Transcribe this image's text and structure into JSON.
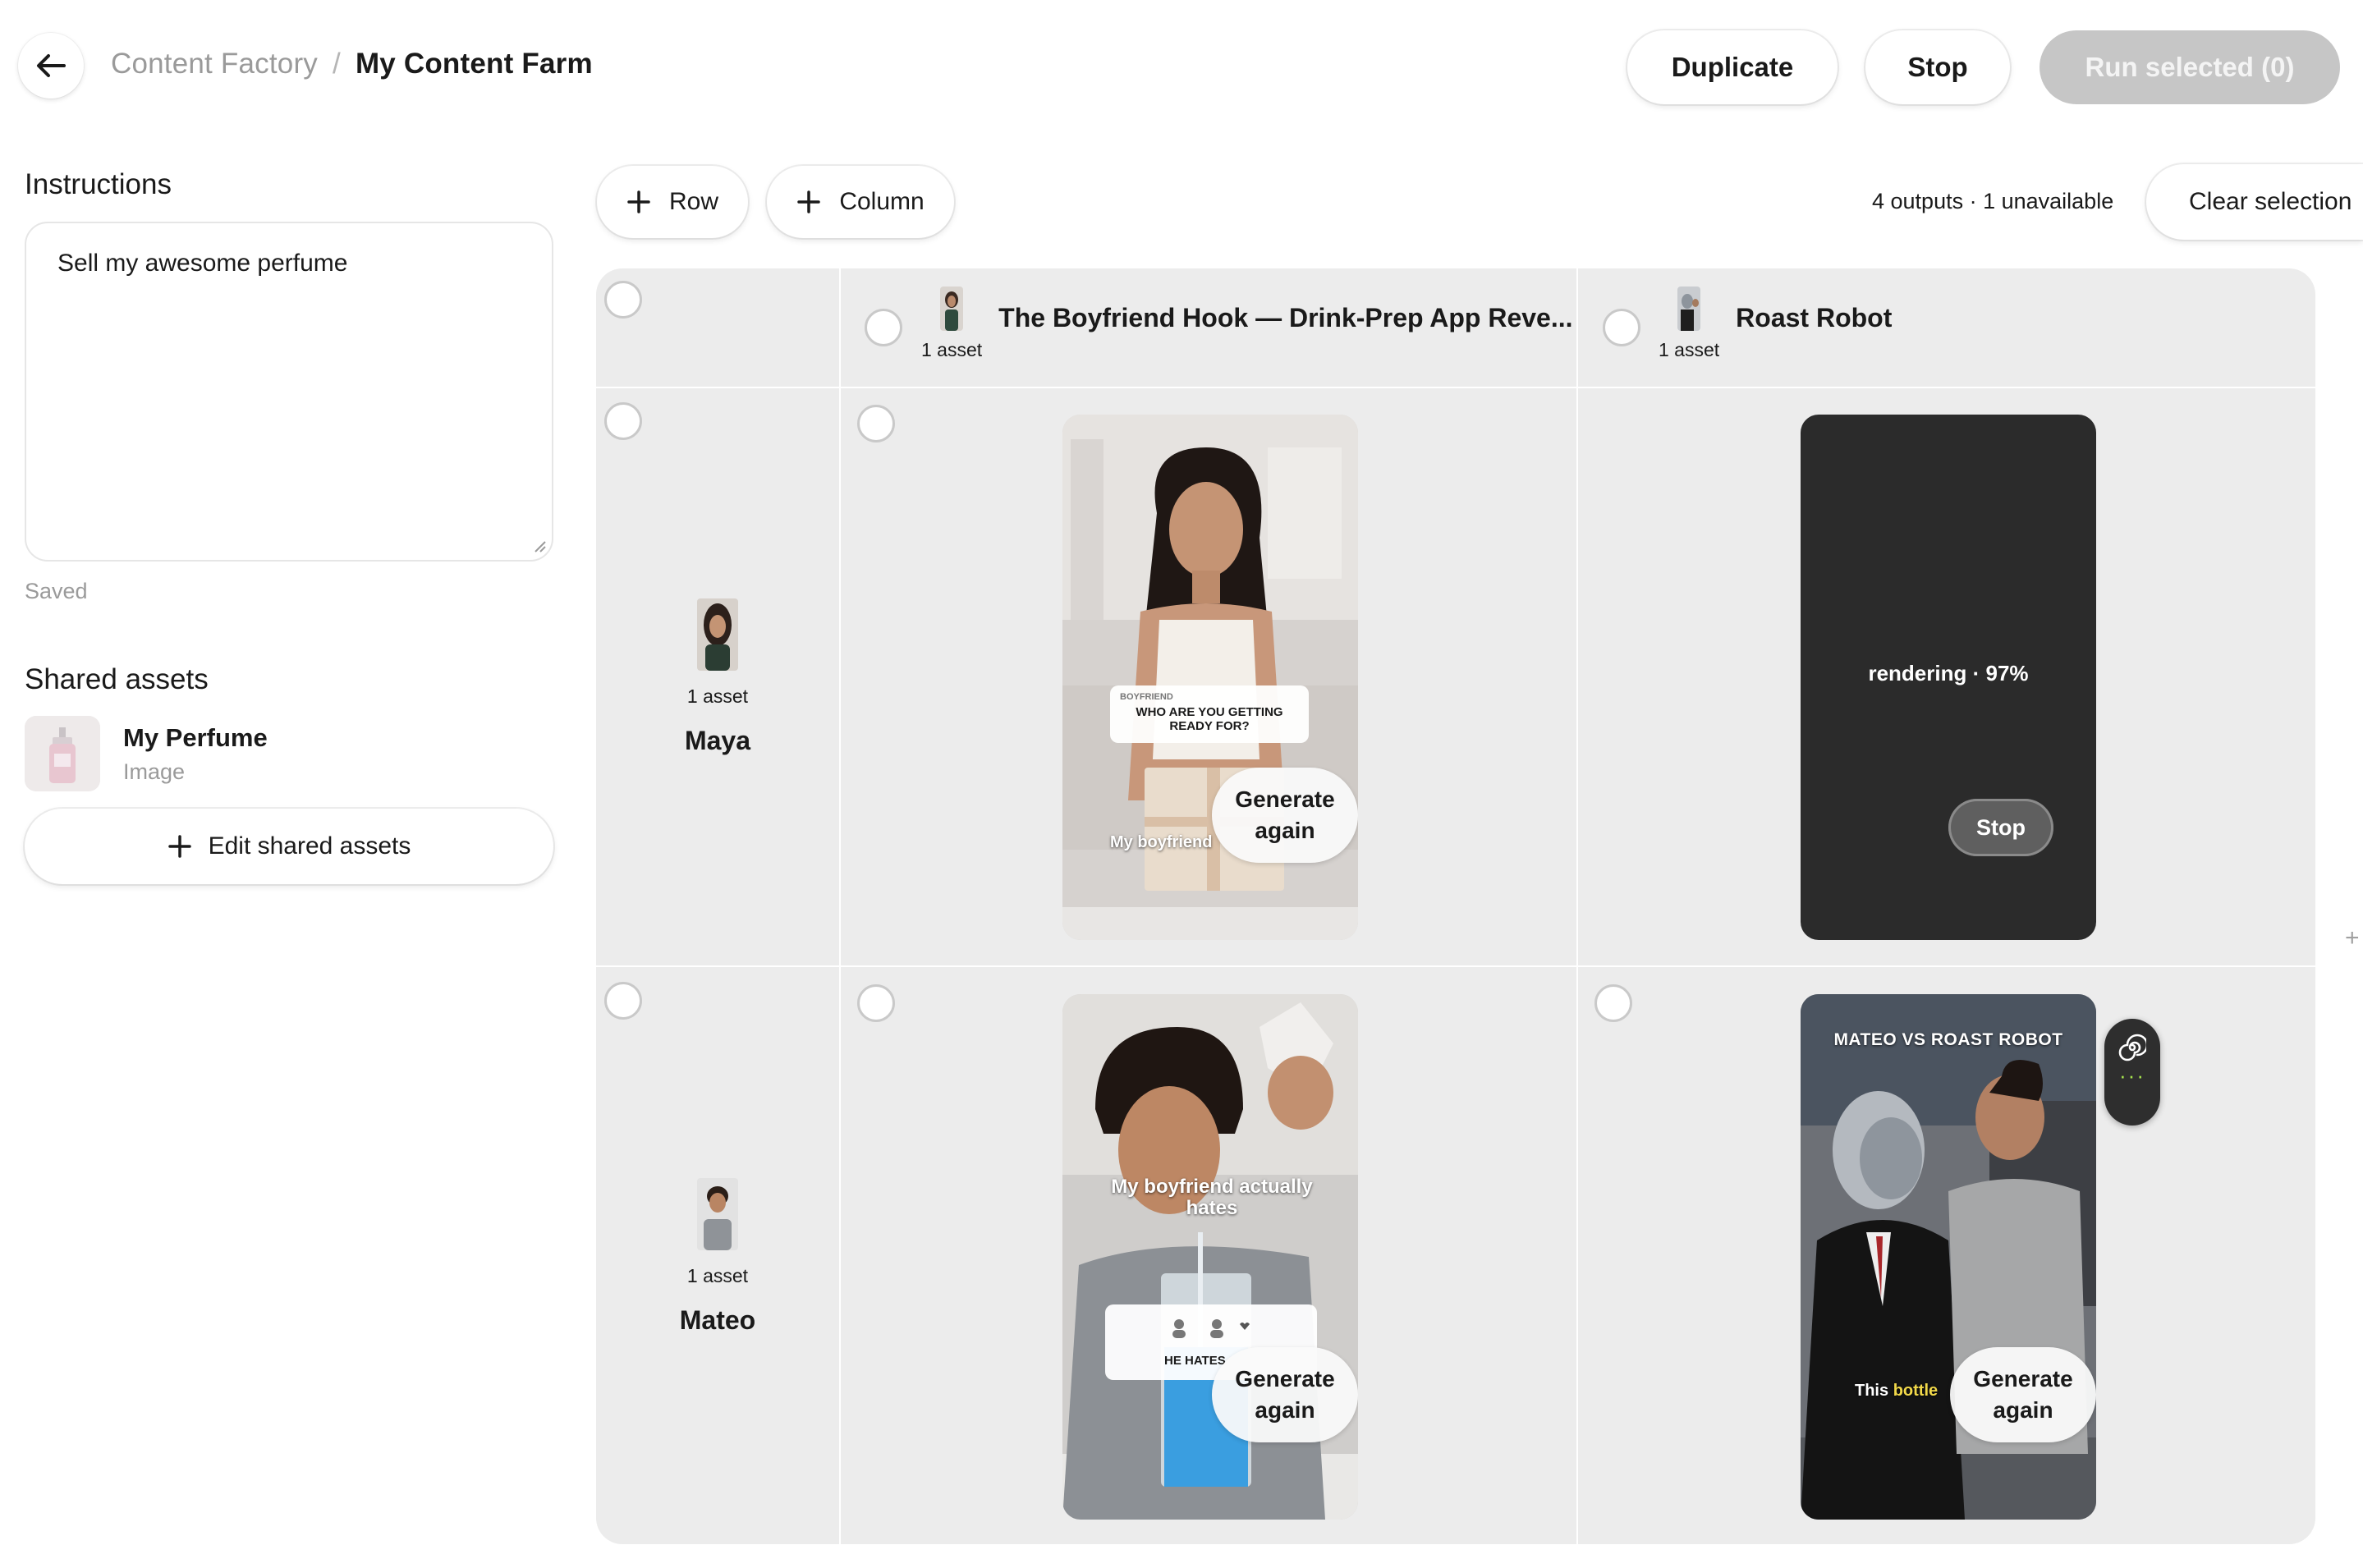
{
  "header": {
    "back_icon": "arrow-left-icon",
    "breadcrumb": {
      "parent": "Content Factory",
      "separator": "/",
      "current": "My Content Farm"
    },
    "actions": {
      "duplicate": "Duplicate",
      "stop": "Stop",
      "run_selected": "Run selected (0)"
    }
  },
  "left_panel": {
    "instructions_title": "Instructions",
    "instructions_value": "Sell my awesome perfume",
    "save_status": "Saved",
    "shared_assets_title": "Shared assets",
    "assets": [
      {
        "name": "My Perfume",
        "type": "Image"
      }
    ],
    "edit_button": "Edit shared assets"
  },
  "toolbar": {
    "add_row": "Row",
    "add_column": "Column",
    "status": "4 outputs · 1 unavailable",
    "clear_selection": "Clear selection"
  },
  "grid": {
    "columns": [
      {
        "title": "The Boyfriend Hook — Drink-Prep App Reve...",
        "assets": "1 asset"
      },
      {
        "title": "Roast Robot",
        "assets": "1 asset"
      }
    ],
    "rows": [
      {
        "name": "Maya",
        "assets": "1 asset"
      },
      {
        "name": "Mateo",
        "assets": "1 asset"
      }
    ],
    "cells": {
      "maya_boyfriend": {
        "caption_label": "BOYFRIEND",
        "caption_text": "WHO ARE YOU GETTING READY FOR?",
        "subtitle": "My boyfriend",
        "generate_label_1": "Generate",
        "generate_label_2": "again"
      },
      "maya_roast": {
        "status": "rendering · 97%",
        "stop_label": "Stop"
      },
      "mateo_boyfriend": {
        "overlay": "My boyfriend actually hates",
        "caption_text": "HE HATES",
        "generate_label_1": "Generate",
        "generate_label_2": "again"
      },
      "mateo_roast": {
        "title_overlay": "MATEO VS ROAST ROBOT",
        "subtitle_white": "This",
        "subtitle_yellow": "bottle",
        "generate_label_1": "Generate",
        "generate_label_2": "again"
      }
    }
  },
  "colors": {
    "accent_green": "#a6e34d",
    "grid_bg": "#ececec",
    "run_disabled": "#c6c6c6"
  }
}
